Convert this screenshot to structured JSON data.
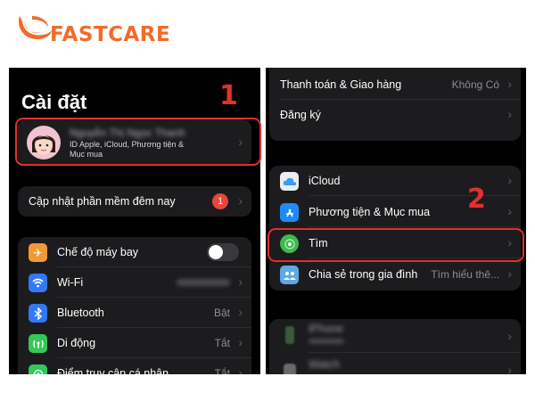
{
  "brand": {
    "name": "FASTCARE",
    "color": "#f26b2a"
  },
  "annotations": {
    "step1": "1",
    "step2": "2",
    "highlight_color": "#e0302f"
  },
  "left": {
    "title": "Cài đặt",
    "profile": {
      "name": "Nguyễn Thị Ngọc Thanh",
      "subtitle_line1": "ID Apple, iCloud, Phương tiện &",
      "subtitle_line2": "Mục mua"
    },
    "update": {
      "label": "Cập nhật phần mềm đêm nay",
      "badge": "1"
    },
    "settings": [
      {
        "label": "Chế độ máy bay",
        "icon": "airplane-icon",
        "color": "#f09a37",
        "control": "toggle-off"
      },
      {
        "label": "Wi-Fi",
        "icon": "wifi-icon",
        "color": "#3478f6",
        "value": "blurred"
      },
      {
        "label": "Bluetooth",
        "icon": "bluetooth-icon",
        "color": "#3478f6",
        "value": "Bật"
      },
      {
        "label": "Di động",
        "icon": "cellular-icon",
        "color": "#34c759",
        "value": "Tắt"
      },
      {
        "label": "Điểm truy cập cá nhân",
        "icon": "hotspot-icon",
        "color": "#34c759",
        "value": "Tắt"
      }
    ]
  },
  "right": {
    "top_rows": [
      {
        "label": "Thanh toán & Giao hàng",
        "value": "Không Có"
      },
      {
        "label": "Đăng ký",
        "value": ""
      }
    ],
    "services": [
      {
        "label": "iCloud",
        "icon": "icloud-icon",
        "color": "#e9eef5"
      },
      {
        "label": "Phương tiện & Mục mua",
        "icon": "app-store-icon",
        "color": "#1d8cf8"
      },
      {
        "label": "Tìm",
        "icon": "find-my-icon",
        "color": "#3fb950"
      },
      {
        "label": "Chia sẻ trong gia đình",
        "icon": "family-sharing-icon",
        "color": "#5fa8e8",
        "value": "Tìm hiểu thê..."
      }
    ],
    "devices": [
      {
        "label": "iPhone",
        "icon": "iphone-icon"
      },
      {
        "label": "Watch",
        "icon": "watch-icon"
      }
    ]
  }
}
